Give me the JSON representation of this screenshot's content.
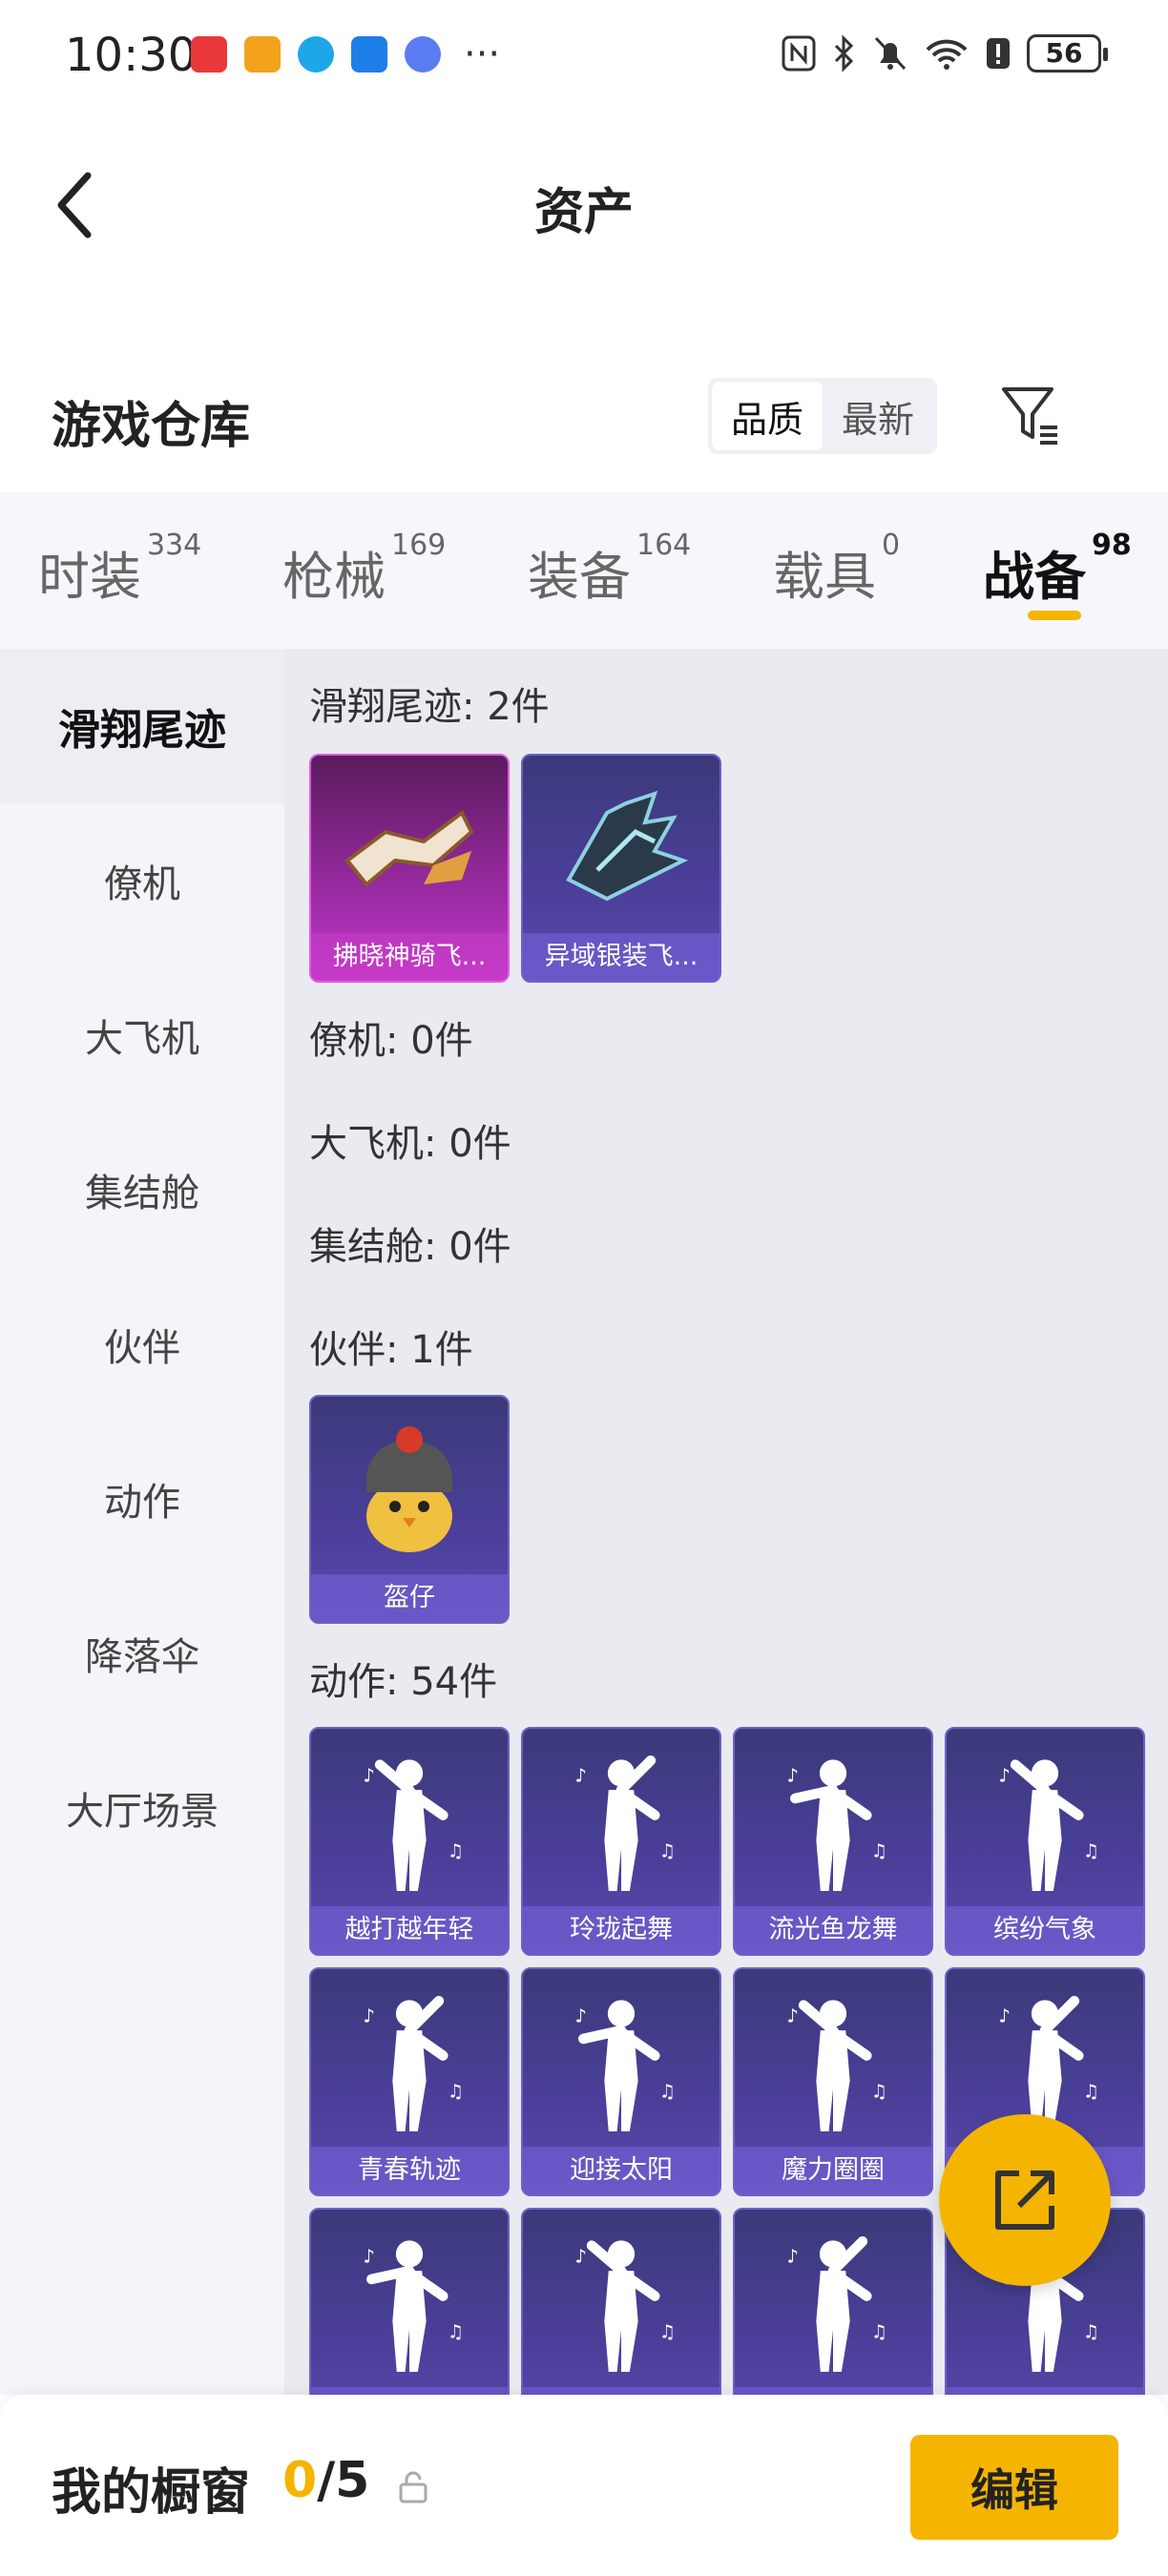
{
  "status_bar": {
    "time": "10:30",
    "battery": "56",
    "app_icons": [
      "huawei-app-icon",
      "orange-app-icon",
      "blue-app-icon",
      "hi-app-icon",
      "music-app-icon"
    ],
    "more": "···"
  },
  "header": {
    "title": "资产"
  },
  "warehouse": {
    "title": "游戏仓库",
    "sort_options": [
      "品质",
      "最新"
    ],
    "active_sort": "品质"
  },
  "tabs": [
    {
      "label": "时装",
      "count": "334"
    },
    {
      "label": "枪械",
      "count": "169"
    },
    {
      "label": "装备",
      "count": "164"
    },
    {
      "label": "载具",
      "count": "0"
    },
    {
      "label": "战备",
      "count": "98",
      "active": true
    }
  ],
  "sidebar": {
    "items": [
      "滑翔尾迹",
      "僚机",
      "大飞机",
      "集结舱",
      "伙伴",
      "动作",
      "降落伞",
      "大厅场景"
    ],
    "active": "滑翔尾迹"
  },
  "sections": {
    "glide": {
      "title": "滑翔尾迹: 2件",
      "items": [
        "拂晓神骑飞...",
        "异域银装飞..."
      ]
    },
    "wingman": {
      "title": "僚机: 0件"
    },
    "plane": {
      "title": "大飞机: 0件"
    },
    "pod": {
      "title": "集结舱: 0件"
    },
    "partner": {
      "title": "伙伴: 1件",
      "items": [
        "盔仔"
      ]
    },
    "emote": {
      "title": "动作: 54件",
      "items": [
        "越打越年轻",
        "玲珑起舞",
        "流光鱼龙舞",
        "缤纷气象",
        "青春轨迹",
        "迎接太阳",
        "魔力圈圈",
        "",
        "",
        "",
        "",
        ""
      ]
    }
  },
  "bottom": {
    "label": "我的橱窗",
    "count_current": "0",
    "count_sep_total": "/5",
    "edit_label": "编辑"
  },
  "colors": {
    "accent": "#f5b400",
    "card_purple": "#4b3f9a",
    "card_pink": "#c23bc8"
  }
}
